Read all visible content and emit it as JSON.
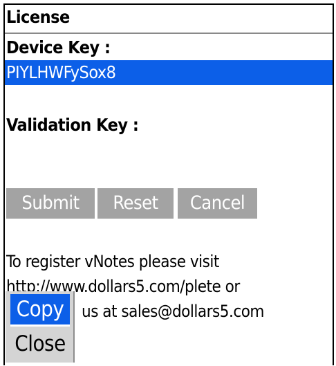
{
  "screen": {
    "title": "License"
  },
  "form": {
    "device_key_label": "Device Key :",
    "device_key_value": "PIYLHWFySox8",
    "validation_key_label": "Validation Key :",
    "validation_key_value": ""
  },
  "buttons": {
    "submit": "Submit",
    "reset": "Reset",
    "cancel": "Cancel"
  },
  "info": {
    "line1": "To register vNotes please visit",
    "line2": "http://www.dollars5.com/plete or",
    "line3": "us at sales@dollars5.com"
  },
  "context_menu": {
    "items": [
      "Copy",
      "Close"
    ],
    "selected": "Copy"
  },
  "colors": {
    "selection": "#0c5fe8",
    "button": "#a3a3a3",
    "menu": "#d4d4d4"
  }
}
